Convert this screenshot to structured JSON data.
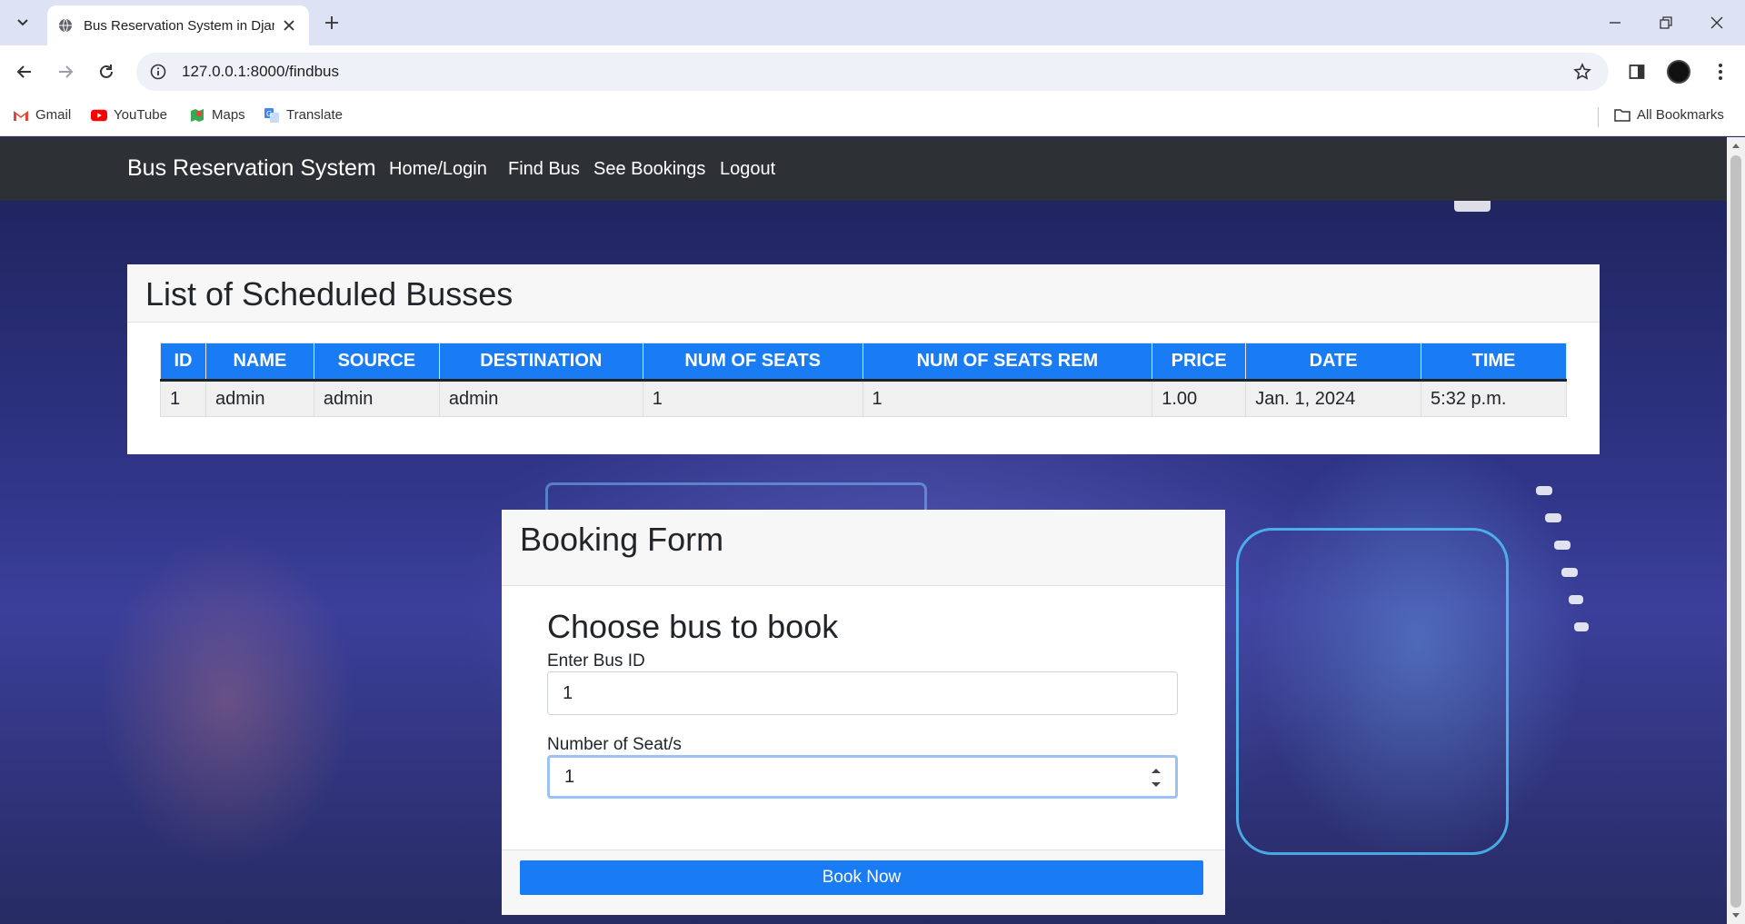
{
  "browser": {
    "tab_title": "Bus Reservation System in Djan",
    "url": "127.0.0.1:8000/findbus",
    "bookmarks": [
      "Gmail",
      "YouTube",
      "Maps",
      "Translate"
    ],
    "all_bookmarks": "All Bookmarks"
  },
  "navbar": {
    "brand": "Bus Reservation System",
    "links": [
      "Home/Login",
      "Find Bus",
      "See Bookings",
      "Logout"
    ]
  },
  "schedule": {
    "title": "List of Scheduled Busses",
    "columns": [
      "ID",
      "NAME",
      "SOURCE",
      "DESTINATION",
      "NUM OF SEATS",
      "NUM OF SEATS REM",
      "PRICE",
      "DATE",
      "TIME"
    ],
    "rows": [
      [
        "1",
        "admin",
        "admin",
        "admin",
        "1",
        "1",
        "1.00",
        "Jan. 1, 2024",
        "5:32 p.m."
      ]
    ]
  },
  "booking": {
    "title": "Booking Form",
    "heading": "Choose bus to book",
    "bus_id_label": "Enter Bus ID",
    "bus_id_value": "1",
    "seats_label": "Number of Seat/s",
    "seats_value": "1",
    "submit_label": "Book Now"
  }
}
